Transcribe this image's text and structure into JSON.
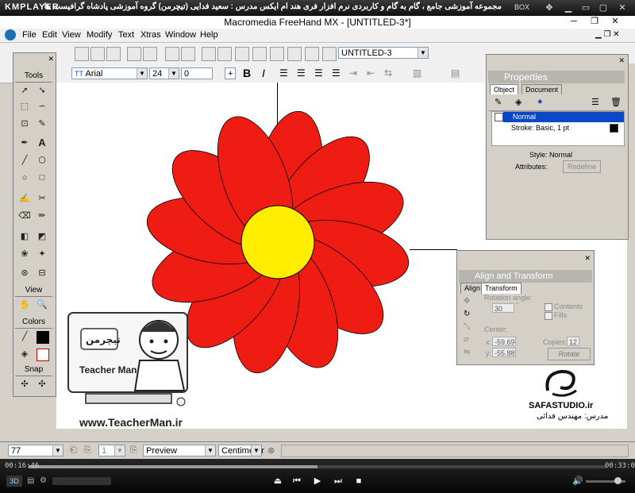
{
  "kmplayer": {
    "logo": "KMPLAYER",
    "title": "مجموعه آموزشی جامع ، گام به گام و کاربردی نرم افزار فری هند ام ایکس   مدرس : سعید فدایی (تیچرمن) گروه آموزشی پادشاه گرافیست ها",
    "box_label": "BOX",
    "time_elapsed": "00:16:46",
    "time_total": "00:33:05",
    "progress": 0.5
  },
  "app": {
    "title": "Macromedia FreeHand MX - [UNTITLED-3*]",
    "menu": [
      "File",
      "Edit",
      "View",
      "Modify",
      "Text",
      "Xtras",
      "Window",
      "Help"
    ],
    "document_select": "UNTITLED-3"
  },
  "text_toolbar": {
    "font": "Arial",
    "size": "24",
    "leading": "0",
    "leading_mode": "+"
  },
  "tools_panel": {
    "title": "Tools",
    "view_label": "View",
    "colors_label": "Colors",
    "snap_label": "Snap"
  },
  "properties": {
    "title": "Properties",
    "tabs": [
      "Object",
      "Document"
    ],
    "fill_row": "Normal",
    "stroke_row": "Stroke: Basic, 1 pt",
    "style_label": "Style: Normal",
    "attributes_label": "Attributes:",
    "redefine_button": "Redefine"
  },
  "align_transform": {
    "title": "Align and Transform",
    "tabs": [
      "Align",
      "Transform"
    ],
    "rotation_label": "Rotation angle:",
    "rotation_value": "30",
    "rotation_unit": "°",
    "contents_label": "Contents",
    "fills_label": "Fills",
    "center_label": "Center:",
    "x_label": "x:",
    "x_value": "-59.69",
    "y_label": "y:",
    "y_value": "-55.88",
    "copies_label": "Copies:",
    "copies_value": "12",
    "rotate_button": "Rotate"
  },
  "statusbar": {
    "zoom": "77",
    "page": "1",
    "view_mode": "Preview",
    "units": "Centimeter"
  },
  "watermark": {
    "logo_text": "تیچرمن",
    "logo_sub": "Teacher Man",
    "url": "www.TeacherMan.ir",
    "studio": "SAFASTUDIO.ir",
    "teacher": "مدرس: مهندس فدائی"
  },
  "colors": {
    "petal": "#ee1c12",
    "center": "#ffed00",
    "panel_title": "#b7b5b0"
  }
}
